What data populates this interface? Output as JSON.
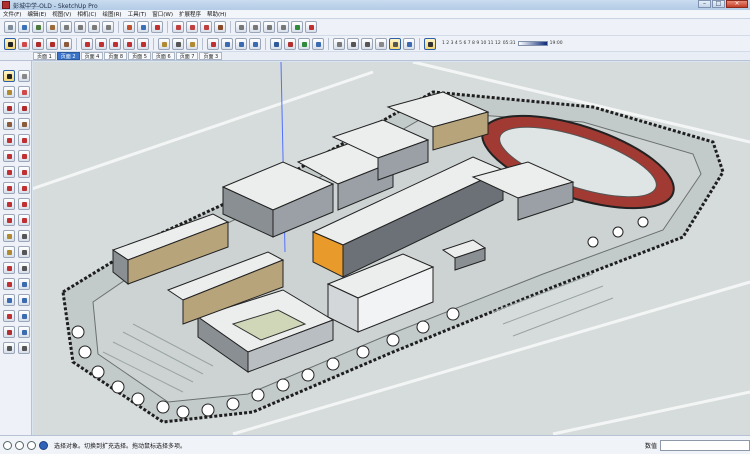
{
  "window": {
    "title": "彭城中学-OLD - SketchUp Pro",
    "minimize": "–",
    "maximize": "□",
    "close": "×"
  },
  "menu": [
    "文件(F)",
    "编辑(E)",
    "视图(V)",
    "相机(C)",
    "绘图(R)",
    "工具(T)",
    "窗口(W)",
    "扩展程序",
    "帮助(H)"
  ],
  "shadow": {
    "months": "1 2 3 4 5 6 7 8 9 10 11 12",
    "time_start": "05:31",
    "time_end": "19:00"
  },
  "scene_tabs": [
    "页面 1",
    "页面 2",
    "页面 4",
    "页面 8",
    "页面 5",
    "页面 6",
    "页面 7",
    "页面 3"
  ],
  "status": {
    "message": "选择对象。切换到扩充选择。拖动鼠标选择多项。",
    "measure_label": "数值",
    "measure_value": ""
  },
  "colors": {
    "accent": "#3a74c8",
    "ground": "#d6dcdc",
    "building_orange": "#e89a2a",
    "track_red": "#a03a32"
  }
}
